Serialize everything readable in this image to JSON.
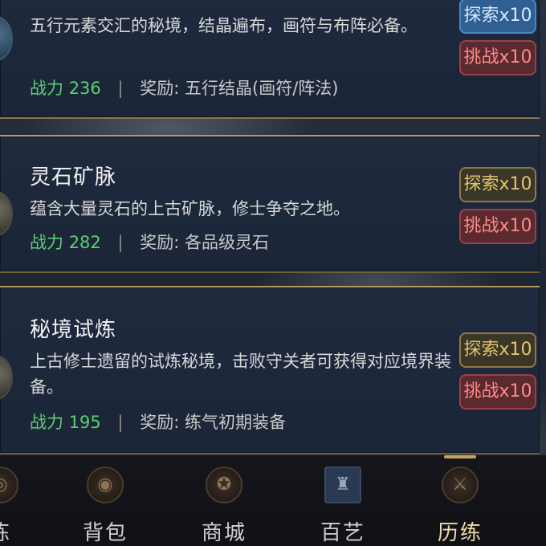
{
  "cards": [
    {
      "title": "",
      "desc": "五行元素交汇的秘境，结晶遍布，画符与布阵必备。",
      "power_label": "战力",
      "power_value": "236",
      "reward_label": "奖励:",
      "reward_value": "五行结晶(画符/阵法)",
      "explore_label": "探索x10",
      "challenge_label": "挑战x10"
    },
    {
      "title": "灵石矿脉",
      "desc": "蕴含大量灵石的上古矿脉，修士争夺之地。",
      "power_label": "战力",
      "power_value": "282",
      "reward_label": "奖励:",
      "reward_value": "各品级灵石",
      "explore_label": "探索x10",
      "challenge_label": "挑战x10"
    },
    {
      "title": "秘境试炼",
      "desc": "上古修士遗留的试炼秘境，击败守关者可获得对应境界装备。",
      "power_label": "战力",
      "power_value": "195",
      "reward_label": "奖励:",
      "reward_value": "练气初期装备",
      "explore_label": "探索x10",
      "challenge_label": "挑战x10"
    }
  ],
  "nav": {
    "items": [
      {
        "label": "炼",
        "icon": "cultivation-icon"
      },
      {
        "label": "背包",
        "icon": "bag-icon"
      },
      {
        "label": "商城",
        "icon": "shop-icon"
      },
      {
        "label": "百艺",
        "icon": "crafts-icon"
      },
      {
        "label": "历练",
        "icon": "trial-icon"
      }
    ],
    "active": "历练"
  },
  "colors": {
    "power": "#5ccf73",
    "explore_blue": "#2f5f93",
    "explore_gold": "#e3c46d",
    "challenge": "#ff8a8a",
    "card_border": "#b89a5a"
  }
}
